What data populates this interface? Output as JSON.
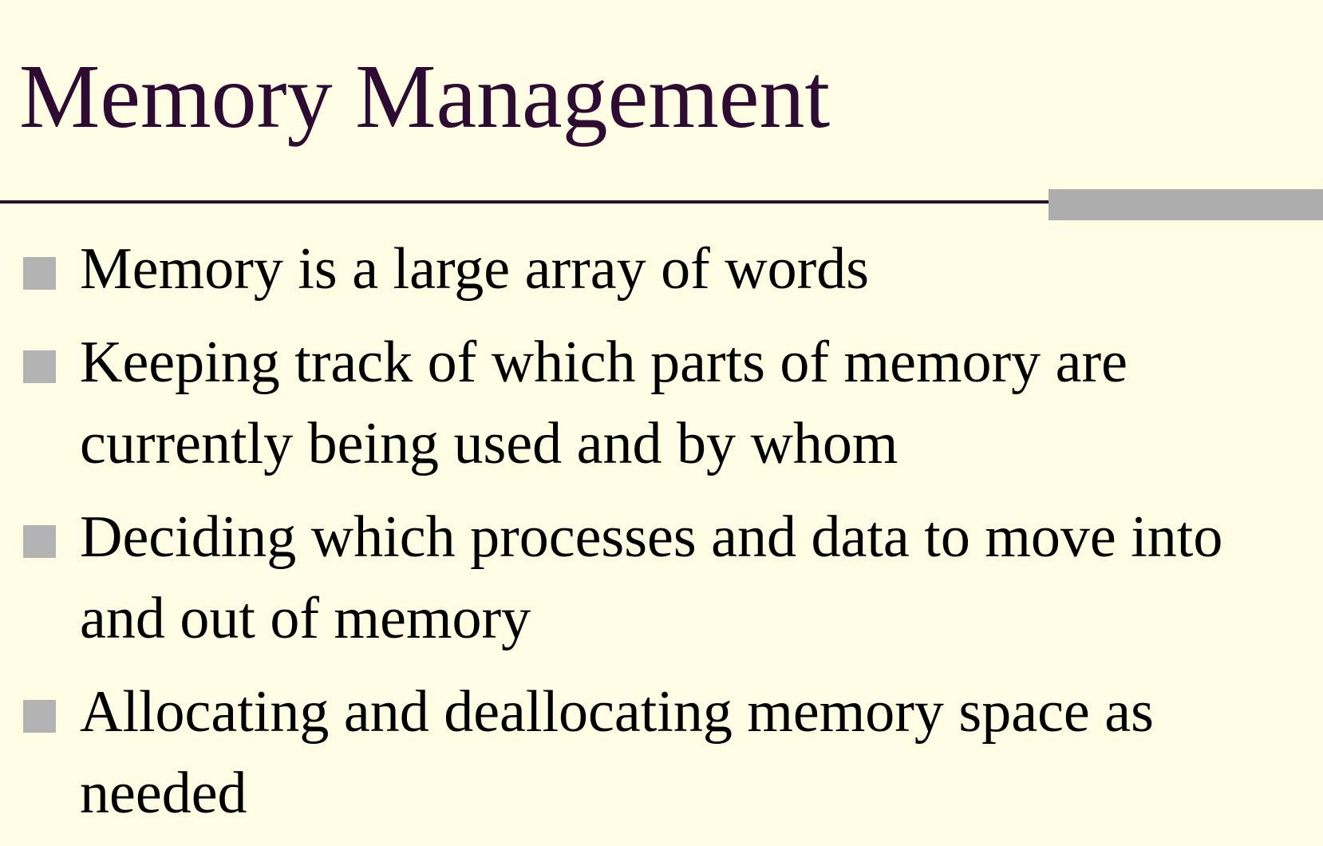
{
  "slide": {
    "title": "Memory Management",
    "bullets": [
      "Memory is a large array of words",
      "Keeping track of which parts of memory are currently being used and by whom",
      "Deciding which processes and data to move into and out of memory",
      "Allocating and deallocating memory space as needed"
    ]
  },
  "colors": {
    "background": "#FEFDE4",
    "title": "#2D0B32",
    "rule": "#2D0B32",
    "accent_bar": "#ADADAD",
    "bullet_marker": "#B3B3B3",
    "text": "#000000"
  },
  "icons": {
    "bullet": "square-bullet-icon"
  }
}
